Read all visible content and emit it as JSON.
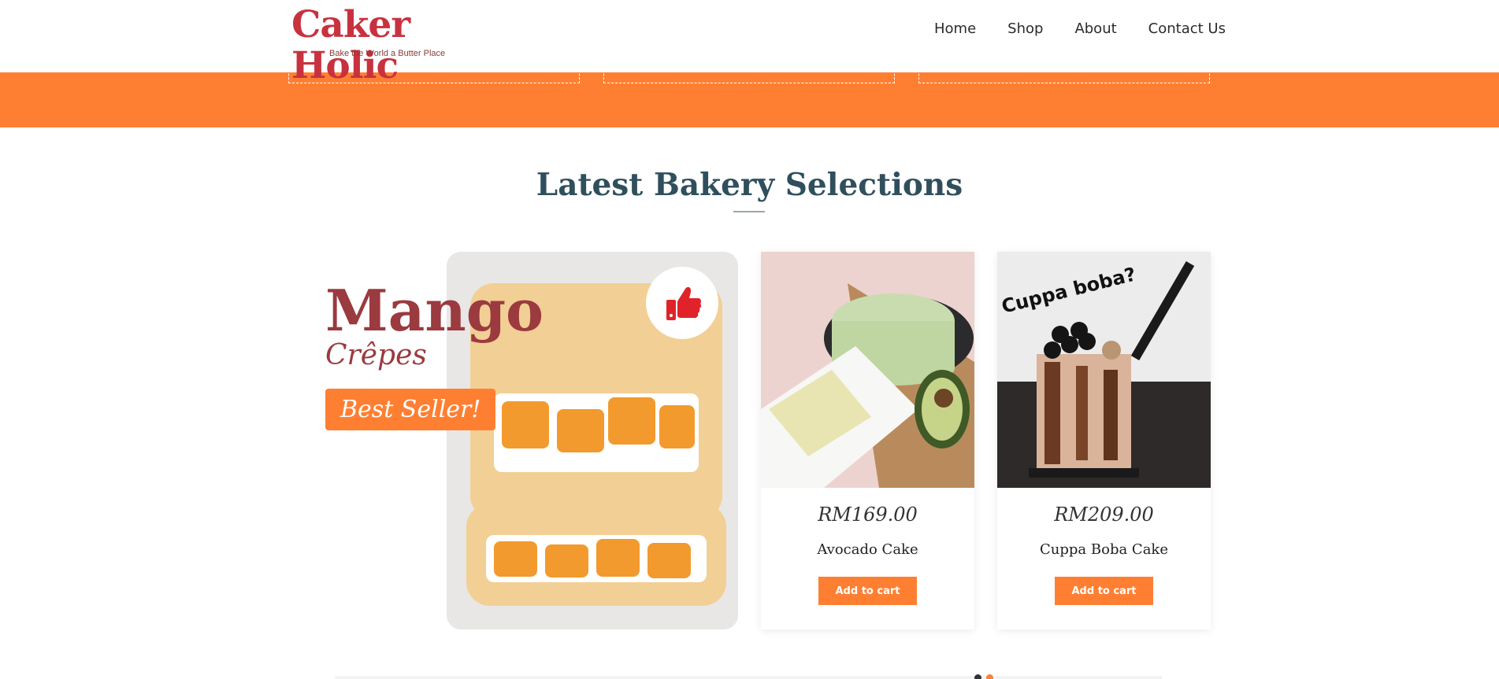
{
  "brand": {
    "name": "Caker Holic",
    "tagline": "Bake the World a Butter Place",
    "color": "#c8323f"
  },
  "nav": {
    "items": [
      "Home",
      "Shop",
      "About",
      "Contact Us"
    ]
  },
  "section": {
    "title": "Latest Bakery Selections"
  },
  "promo": {
    "title": "Mango",
    "subtitle": "Crêpes",
    "badge": "Best Seller!",
    "badge_icon": "thumbs-up-icon"
  },
  "products": [
    {
      "name": "Avocado Cake",
      "price": "RM169.00",
      "button": "Add to cart"
    },
    {
      "name": "Cuppa Boba Cake",
      "price": "RM209.00",
      "button": "Add to cart"
    }
  ],
  "colors": {
    "accent": "#ff7f32",
    "heading": "#2f4f5c",
    "promo": "#9b3a3f"
  }
}
